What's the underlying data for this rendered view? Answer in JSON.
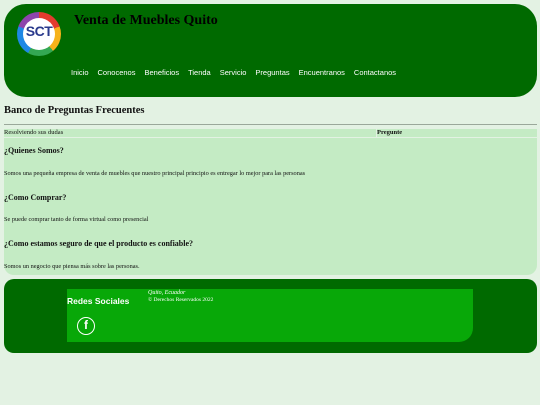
{
  "header": {
    "logo_text": "SCT",
    "site_title": "Venta de Muebles Quito",
    "nav": [
      "Inicio",
      "Conocenos",
      "Beneficios",
      "Tienda",
      "Servicio",
      "Preguntas",
      "Encuentranos",
      "Contactanos"
    ]
  },
  "main": {
    "title": "Banco de Preguntas Frecuentes",
    "table_head_left": "Resolviendo sus dudas",
    "table_head_right": "Pregunte",
    "faq": [
      {
        "q": "¿Quienes Somos?",
        "a": "Somos una pequeña empresa de venta de muebles que nuestro principal principio es entregar lo mejor para las personas"
      },
      {
        "q": "¿Como Comprar?",
        "a": "Se puede comprar tanto de forma virtual como presencial"
      },
      {
        "q": "¿Como estamos seguro de que el producto es confiable?",
        "a": "Somos un negocio que piensa más sobre las personas."
      }
    ]
  },
  "footer": {
    "social_title": "Redes Sociales",
    "location": "Quito, Ecuador",
    "rights": "© Derechos Reservados 2022",
    "facebook_glyph": "f"
  },
  "colors": {
    "header_green": "#006a00",
    "footer_card": "#08a808",
    "faq_bg": "#c4ebc4",
    "page_bg": "#e3f2e3"
  }
}
